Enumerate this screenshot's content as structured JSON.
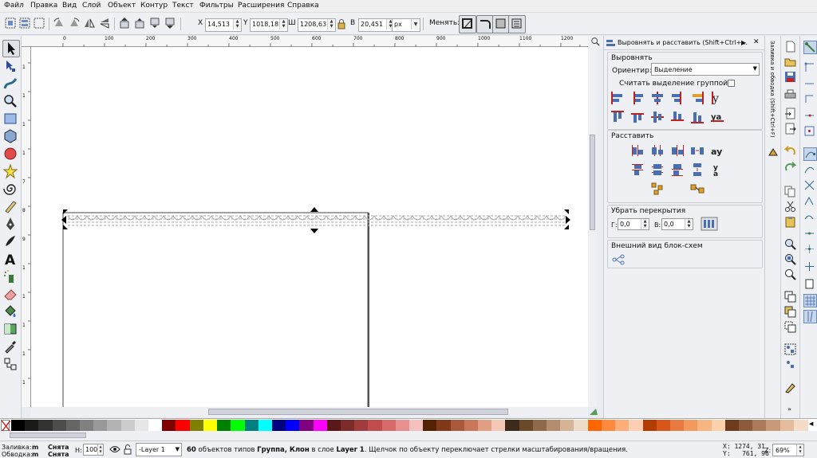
{
  "menu": [
    "Файл",
    "Правка",
    "Вид",
    "Слой",
    "Объект",
    "Контур",
    "Текст",
    "Фильтры",
    "Расширения",
    "Справка"
  ],
  "toolbar": {
    "x_label": "X",
    "x_value": "14,513",
    "y_label": "Y",
    "y_value": "1018,18",
    "w_label": "Ш",
    "w_value": "1208,63",
    "h_label": "В",
    "h_value": "20,451",
    "unit": "px",
    "change_label": "Менять:"
  },
  "ruler": {
    "h_ticks": [
      "0",
      "100",
      "200",
      "300",
      "400",
      "500",
      "600",
      "700",
      "800",
      "900",
      "1000",
      "1100",
      "1200"
    ],
    "v_ticks": [
      "1",
      "1",
      "1",
      "1",
      "7",
      "8",
      "9",
      "1",
      "1",
      "1",
      "1",
      "1",
      "1"
    ]
  },
  "dock": {
    "title": "Выровнять и расставить (Shift+Ctrl+...",
    "align_section": "Выровнять",
    "relative_label": "Ориентир:",
    "relative_value": "Выделение",
    "group_label": "Считать выделение группой:",
    "distribute_section": "Расставить",
    "overlap_section": "Убрать перекрытия",
    "h_label": "Г:",
    "h_value": "0,0",
    "v_label": "В:",
    "v_value": "0,0",
    "connector_section": "Внешний вид блок-схем",
    "vtab_label": "Заливка и обводка (Shift+Ctrl+F)"
  },
  "status": {
    "fill_label": "Заливка:",
    "fill_m": "m",
    "fill_value": "Снята",
    "stroke_label": "Обводка:",
    "stroke_m": "m",
    "stroke_value": "Снята",
    "opacity_label": "Н:",
    "opacity_value": "100",
    "layer_value": "-Layer 1",
    "message_count": "60",
    "message_a": " объектов типов ",
    "message_b": "Группа, Клон",
    "message_c": " в слое ",
    "message_d": "Layer 1",
    "message_e": ". Щелчок по объекту переключает стрелки масштабирования/вращения.",
    "coord_x": "X: 1274, 31",
    "coord_y": "Y:   761, 96",
    "zoom_label": "Z:",
    "zoom_value": "69%"
  },
  "palette_colors": [
    "#000000",
    "#1a1a1a",
    "#333333",
    "#4d4d4d",
    "#666666",
    "#808080",
    "#999999",
    "#b3b3b3",
    "#cccccc",
    "#e6e6e6",
    "#ffffff",
    "#800000",
    "#ff0000",
    "#808000",
    "#ffff00",
    "#008000",
    "#00ff00",
    "#008080",
    "#00ffff",
    "#000080",
    "#0000ff",
    "#800080",
    "#ff00ff",
    "#5a1818",
    "#7d2a2a",
    "#a03c3c",
    "#c24b4b",
    "#d96a6a",
    "#e89090",
    "#f4c0c0",
    "#552200",
    "#803a1a",
    "#aa5a3a",
    "#c87858",
    "#e29e82",
    "#f3c8b5",
    "#3e2a1a",
    "#6b4a2a",
    "#8f6a4a",
    "#b38d6d",
    "#d4b396",
    "#ecdcc8",
    "#ff6600",
    "#ff8a3d",
    "#ffae7a",
    "#ffcfb3",
    "#b33c00",
    "#d9561a",
    "#e97a3f",
    "#f29a5e",
    "#f7b582",
    "#fcd2ad",
    "#6e3b1e",
    "#8d5a3a",
    "#ab7a58",
    "#c99a78",
    "#e5bd9e",
    "#f4dcc8"
  ]
}
